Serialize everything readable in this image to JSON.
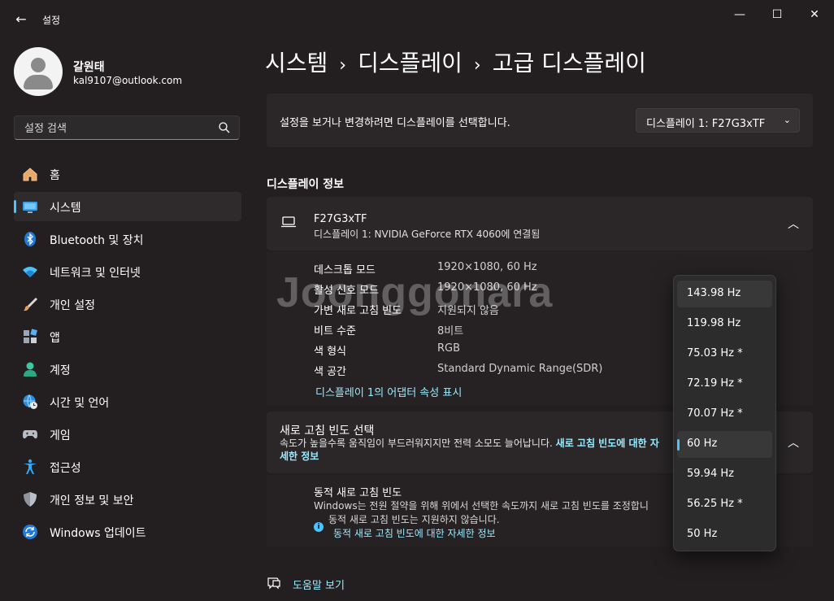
{
  "window": {
    "title": "설정",
    "back_icon": "←",
    "minimize_icon": "—",
    "maximize_icon": "☐",
    "close_icon": "✕"
  },
  "user": {
    "name": "갈원태",
    "email": "kal9107@outlook.com"
  },
  "search": {
    "placeholder": "설정 검색"
  },
  "nav": [
    {
      "label": "홈",
      "icon": "home-icon"
    },
    {
      "label": "시스템",
      "icon": "system-icon",
      "active": true
    },
    {
      "label": "Bluetooth 및 장치",
      "icon": "bluetooth-icon"
    },
    {
      "label": "네트워크 및 인터넷",
      "icon": "wifi-icon"
    },
    {
      "label": "개인 설정",
      "icon": "brush-icon"
    },
    {
      "label": "앱",
      "icon": "apps-icon"
    },
    {
      "label": "계정",
      "icon": "account-icon"
    },
    {
      "label": "시간 및 언어",
      "icon": "globe-clock-icon"
    },
    {
      "label": "게임",
      "icon": "gamepad-icon"
    },
    {
      "label": "접근성",
      "icon": "accessibility-icon"
    },
    {
      "label": "개인 정보 및 보안",
      "icon": "shield-icon"
    },
    {
      "label": "Windows 업데이트",
      "icon": "update-icon"
    }
  ],
  "breadcrumb": [
    "시스템",
    "디스플레이",
    "고급 디스플레이"
  ],
  "breadcrumb_sep": "›",
  "select_display": {
    "prompt": "설정을 보거나 변경하려면 디스플레이를 선택합니다.",
    "value": "디스플레이 1: F27G3xTF"
  },
  "display_info": {
    "section_title": "디스플레이 정보",
    "monitor_name": "F27G3xTF",
    "monitor_sub": "디스플레이 1: NVIDIA GeForce RTX 4060에 연결됨",
    "rows": [
      {
        "label": "데스크톱 모드",
        "value": "1920×1080, 60 Hz"
      },
      {
        "label": "활성 신호 모드",
        "value": "1920×1080, 60 Hz"
      },
      {
        "label": "가변 새로 고침 빈도",
        "value": "지원되지 않음"
      },
      {
        "label": "비트 수준",
        "value": "8비트"
      },
      {
        "label": "색 형식",
        "value": "RGB"
      },
      {
        "label": "색 공간",
        "value": "Standard Dynamic Range(SDR)"
      }
    ],
    "adapter_link": "디스플레이 1의 어댑터 속성 표시"
  },
  "refresh": {
    "title": "새로 고침 빈도 선택",
    "desc": "속도가 높을수록 움직임이 부드러워지지만 전력 소모도 늘어납니다.",
    "desc_link": "새로 고침 빈도에 대한 자세한 정보",
    "dynamic_title": "동적 새로 고침 빈도",
    "dynamic_desc": "Windows는 전원 절약을 위해 위에서 선택한 속도까지 새로 고침 빈도를 조정합니",
    "dynamic_note": "동적 새로 고침 빈도는 지원하지 않습니다.",
    "dynamic_link": "동적 새로 고침 빈도에 대한 자세한 정보",
    "info_glyph": "i"
  },
  "refresh_options": [
    {
      "label": "143.98 Hz",
      "state": "hover"
    },
    {
      "label": "119.98 Hz"
    },
    {
      "label": "75.03 Hz *"
    },
    {
      "label": "72.19 Hz *"
    },
    {
      "label": "70.07 Hz *"
    },
    {
      "label": "60 Hz",
      "state": "selected"
    },
    {
      "label": "59.94 Hz"
    },
    {
      "label": "56.25 Hz *"
    },
    {
      "label": "50 Hz"
    }
  ],
  "help": {
    "label": "도움말 보기"
  },
  "watermark": "Joonggonara",
  "colors": {
    "accent": "#4cc2ff",
    "link": "#99ebff",
    "background": "#231f20",
    "card": "#2b2728"
  }
}
